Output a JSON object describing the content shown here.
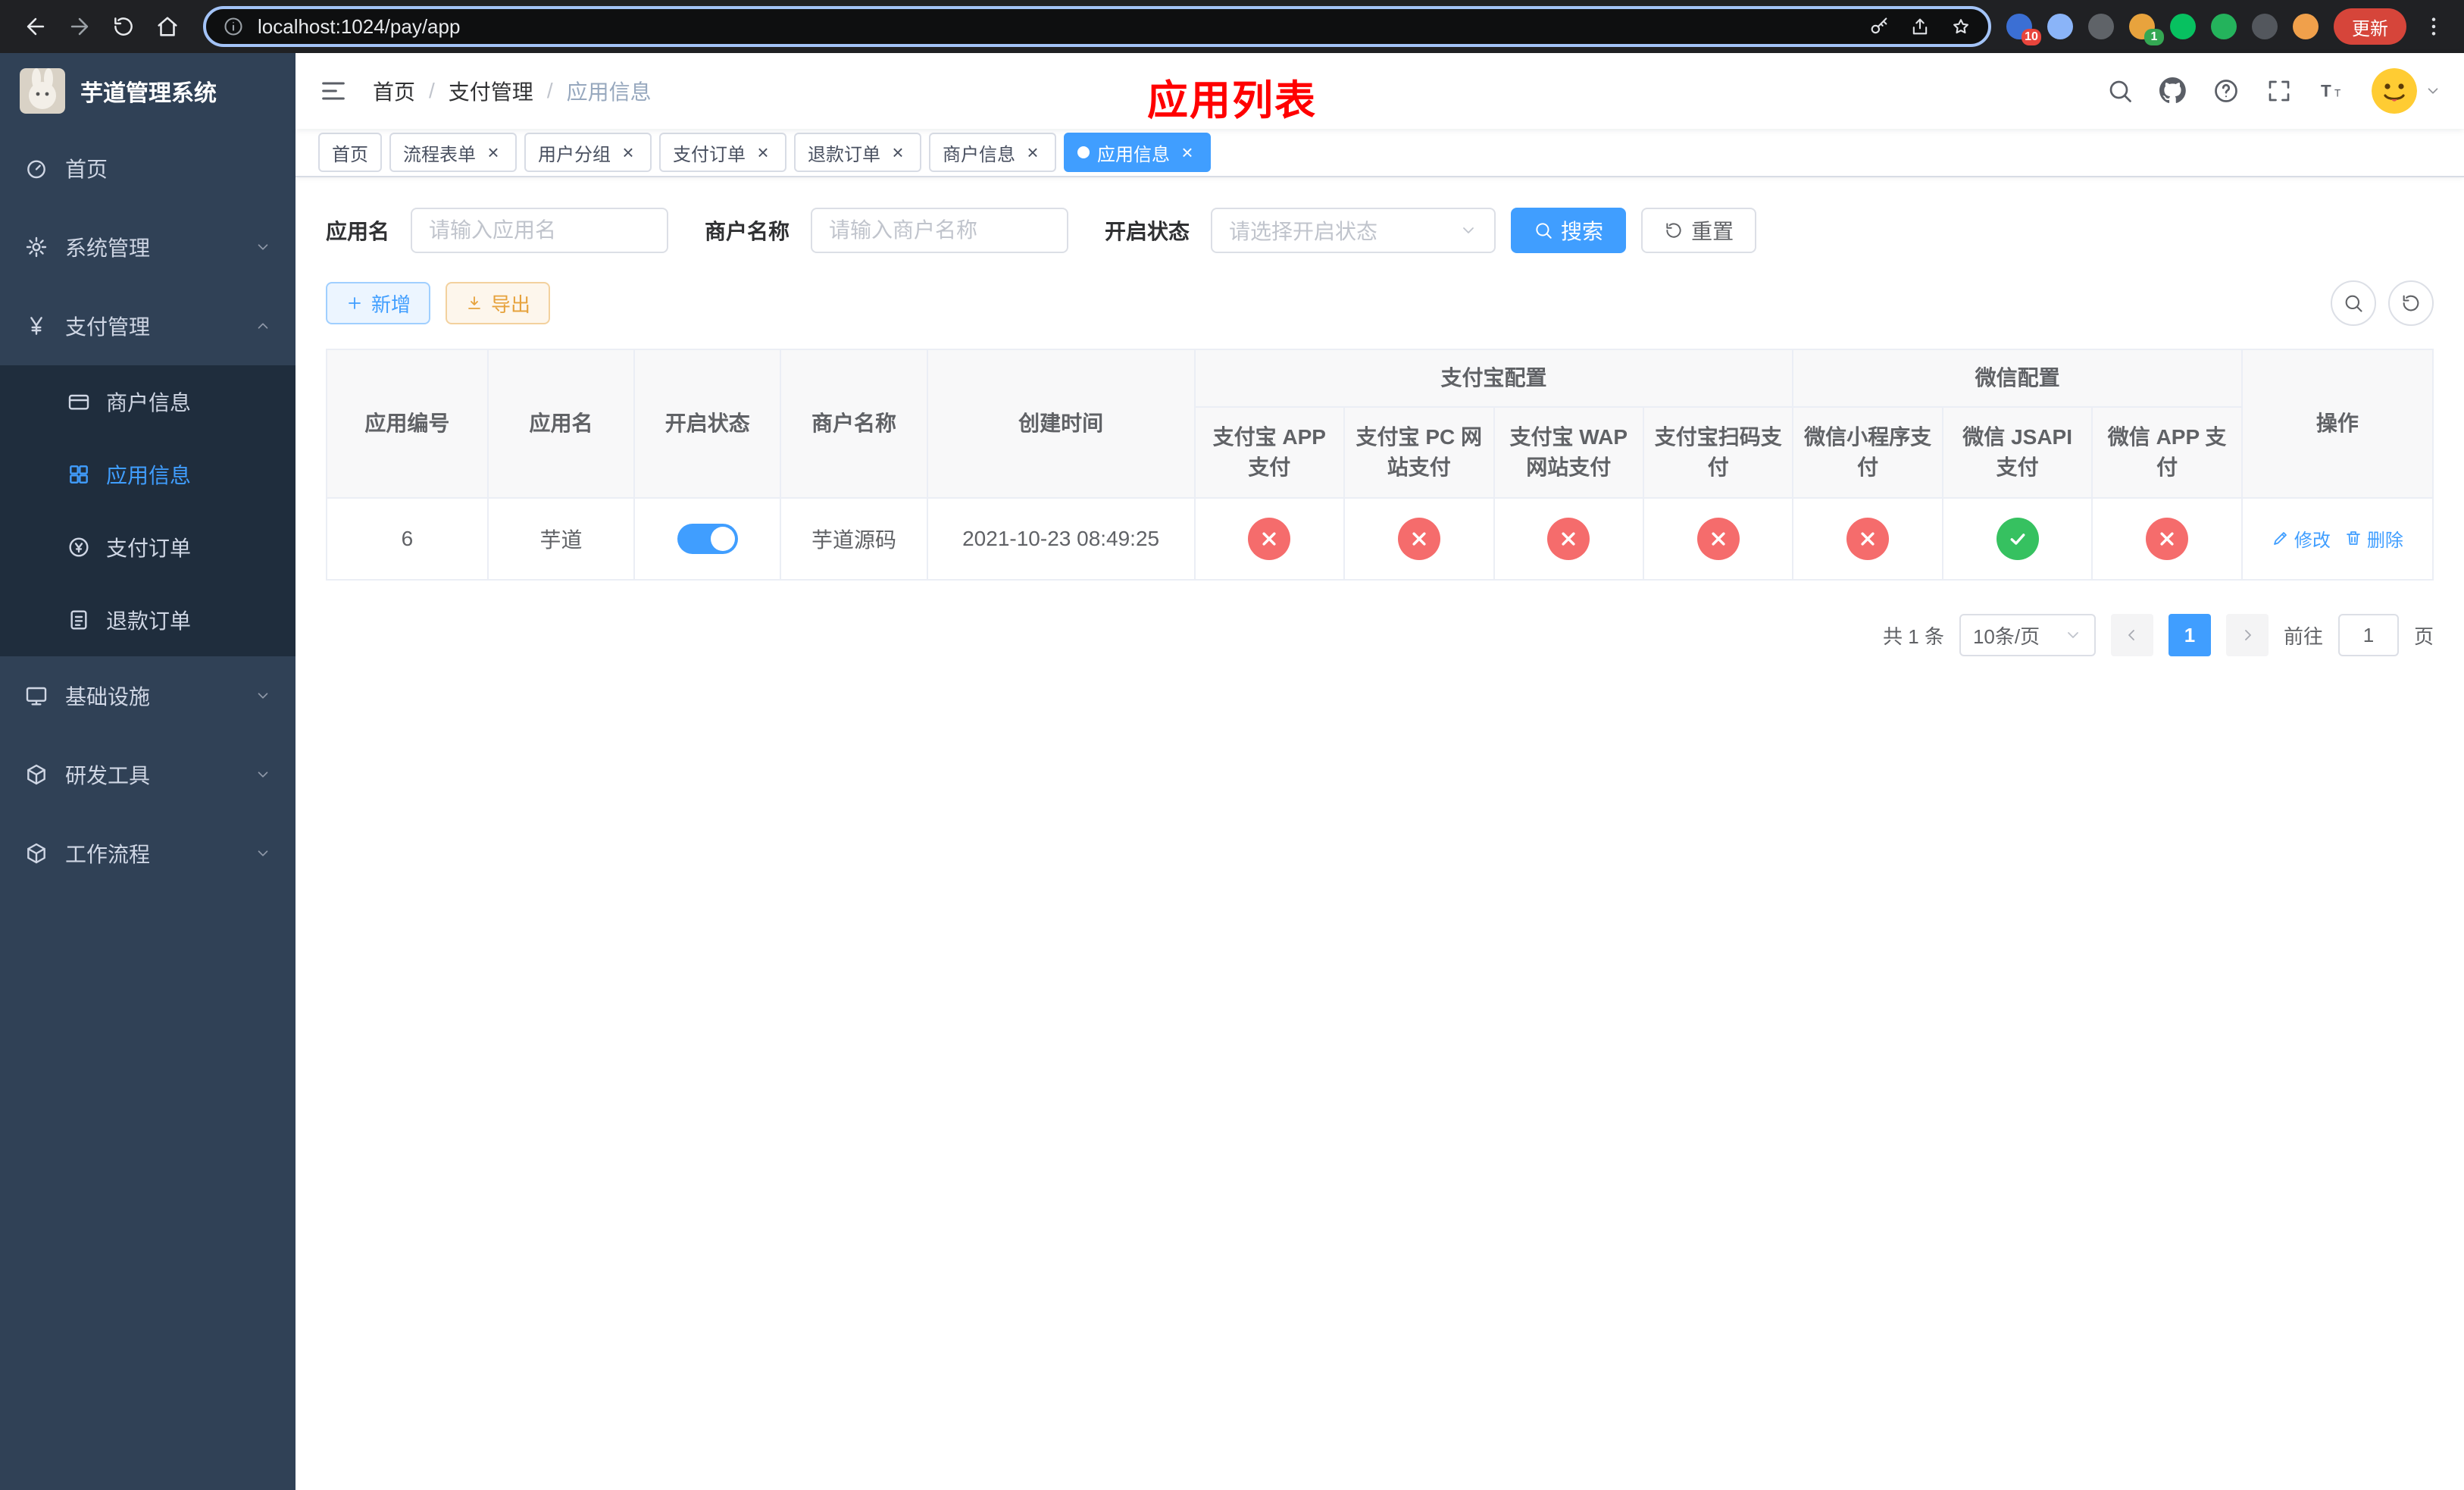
{
  "browser": {
    "url": "localhost:1024/pay/app",
    "update_label": "更新",
    "extensions": [
      {
        "key": "extension-blue-red",
        "color": "#3b6fd4",
        "badge": "10",
        "badge_color": "#e8453c"
      },
      {
        "key": "extension-blue-drop",
        "color": "#8ab4f8",
        "badge": "",
        "badge_color": ""
      },
      {
        "key": "extension-dark-circle",
        "color": "#5f6368",
        "badge": "",
        "badge_color": ""
      },
      {
        "key": "extension-avatar",
        "color": "#e8a33d",
        "badge": "1",
        "badge_color": "#34a853"
      },
      {
        "key": "extension-green-circle",
        "color": "#07c160",
        "badge": "",
        "badge_color": ""
      },
      {
        "key": "extension-green-square",
        "color": "#24b35c",
        "badge": "",
        "badge_color": ""
      },
      {
        "key": "extension-pin",
        "color": "#53575d",
        "badge": "",
        "badge_color": ""
      },
      {
        "key": "extension-emoji",
        "color": "#f0a04b",
        "badge": "",
        "badge_color": ""
      }
    ]
  },
  "sidebar": {
    "title": "芋道管理系统",
    "menu": [
      {
        "key": "home",
        "label": "首页",
        "icon": "dashboard",
        "type": "item",
        "expanded": false
      },
      {
        "key": "system-management",
        "label": "系统管理",
        "icon": "gear",
        "type": "group",
        "expanded": false
      },
      {
        "key": "payment-management",
        "label": "支付管理",
        "icon": "yen",
        "type": "group",
        "expanded": true,
        "children": [
          {
            "key": "merchant-info",
            "label": "商户信息",
            "icon": "card",
            "active": false
          },
          {
            "key": "app-info",
            "label": "应用信息",
            "icon": "grid",
            "active": true
          },
          {
            "key": "payment-orders",
            "label": "支付订单",
            "icon": "pay-order",
            "active": false
          },
          {
            "key": "refund-orders",
            "label": "退款订单",
            "icon": "refund-doc",
            "active": false
          }
        ]
      },
      {
        "key": "infrastructure",
        "label": "基础设施",
        "icon": "monitor",
        "type": "group",
        "expanded": false
      },
      {
        "key": "dev-tools",
        "label": "研发工具",
        "icon": "cube",
        "type": "group",
        "expanded": false
      },
      {
        "key": "workflow",
        "label": "工作流程",
        "icon": "cube",
        "type": "group",
        "expanded": false
      }
    ]
  },
  "header": {
    "breadcrumb": [
      "首页",
      "支付管理",
      "应用信息"
    ],
    "annotation": "应用列表"
  },
  "tabs": [
    {
      "key": "home",
      "label": "首页",
      "closable": false,
      "active": false
    },
    {
      "key": "process-form",
      "label": "流程表单",
      "closable": true,
      "active": false
    },
    {
      "key": "user-group",
      "label": "用户分组",
      "closable": true,
      "active": false
    },
    {
      "key": "payment-order",
      "label": "支付订单",
      "closable": true,
      "active": false
    },
    {
      "key": "refund-order",
      "label": "退款订单",
      "closable": true,
      "active": false
    },
    {
      "key": "merchant-info",
      "label": "商户信息",
      "closable": true,
      "active": false
    },
    {
      "key": "app-info",
      "label": "应用信息",
      "closable": true,
      "active": true
    }
  ],
  "filters": {
    "app_name_label": "应用名",
    "app_name_placeholder": "请输入应用名",
    "merchant_label": "商户名称",
    "merchant_placeholder": "请输入商户名称",
    "status_label": "开启状态",
    "status_placeholder": "请选择开启状态",
    "search_button": "搜索",
    "reset_button": "重置"
  },
  "toolbar": {
    "add_button": "新增",
    "export_button": "导出"
  },
  "table": {
    "columns": {
      "app_id": "应用编号",
      "app_name": "应用名",
      "status": "开启状态",
      "merchant": "商户名称",
      "created": "创建时间",
      "alipay_group": "支付宝配置",
      "wechat_group": "微信配置",
      "actions": "操作"
    },
    "config_columns": [
      {
        "key": "alipay-app",
        "label": "支付宝 APP 支付"
      },
      {
        "key": "alipay-pc",
        "label": "支付宝 PC 网站支付"
      },
      {
        "key": "alipay-wap",
        "label": "支付宝 WAP 网站支付"
      },
      {
        "key": "alipay-qr",
        "label": "支付宝扫码支付"
      },
      {
        "key": "wx-mini",
        "label": "微信小程序支付"
      },
      {
        "key": "wx-jsapi",
        "label": "微信 JSAPI 支付"
      },
      {
        "key": "wx-app",
        "label": "微信 APP 支付"
      }
    ],
    "row": {
      "app_id": "6",
      "app_name": "芋道",
      "status_on": true,
      "merchant": "芋道源码",
      "created": "2021-10-23 08:49:25",
      "configs": [
        false,
        false,
        false,
        false,
        false,
        true,
        false
      ],
      "edit_label": "修改",
      "delete_label": "删除"
    }
  },
  "pagination": {
    "total_text": "共 1 条",
    "page_size": "10条/页",
    "current_page": "1",
    "goto_label": "前往",
    "goto_value": "1",
    "goto_suffix": "页"
  },
  "colors": {
    "primary": "#409eff",
    "danger": "#f56c6c",
    "success": "#36c160",
    "warning": "#e6a23c",
    "annotation_red": "#ff0000"
  }
}
